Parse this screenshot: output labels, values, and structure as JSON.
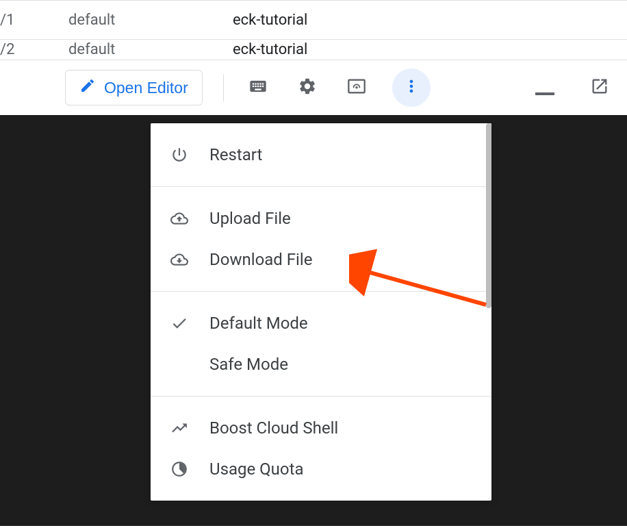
{
  "table": {
    "rows": [
      {
        "col1": "/1",
        "col2": "default",
        "col3": "eck-tutorial"
      },
      {
        "col1": "/2",
        "col2": "default",
        "col3": "eck-tutorial"
      }
    ]
  },
  "toolbar": {
    "open_editor_label": "Open Editor"
  },
  "menu": {
    "restart_label": "Restart",
    "upload_label": "Upload File",
    "download_label": "Download File",
    "default_mode_label": "Default Mode",
    "safe_mode_label": "Safe Mode",
    "boost_label": "Boost Cloud Shell",
    "usage_quota_label": "Usage Quota"
  }
}
